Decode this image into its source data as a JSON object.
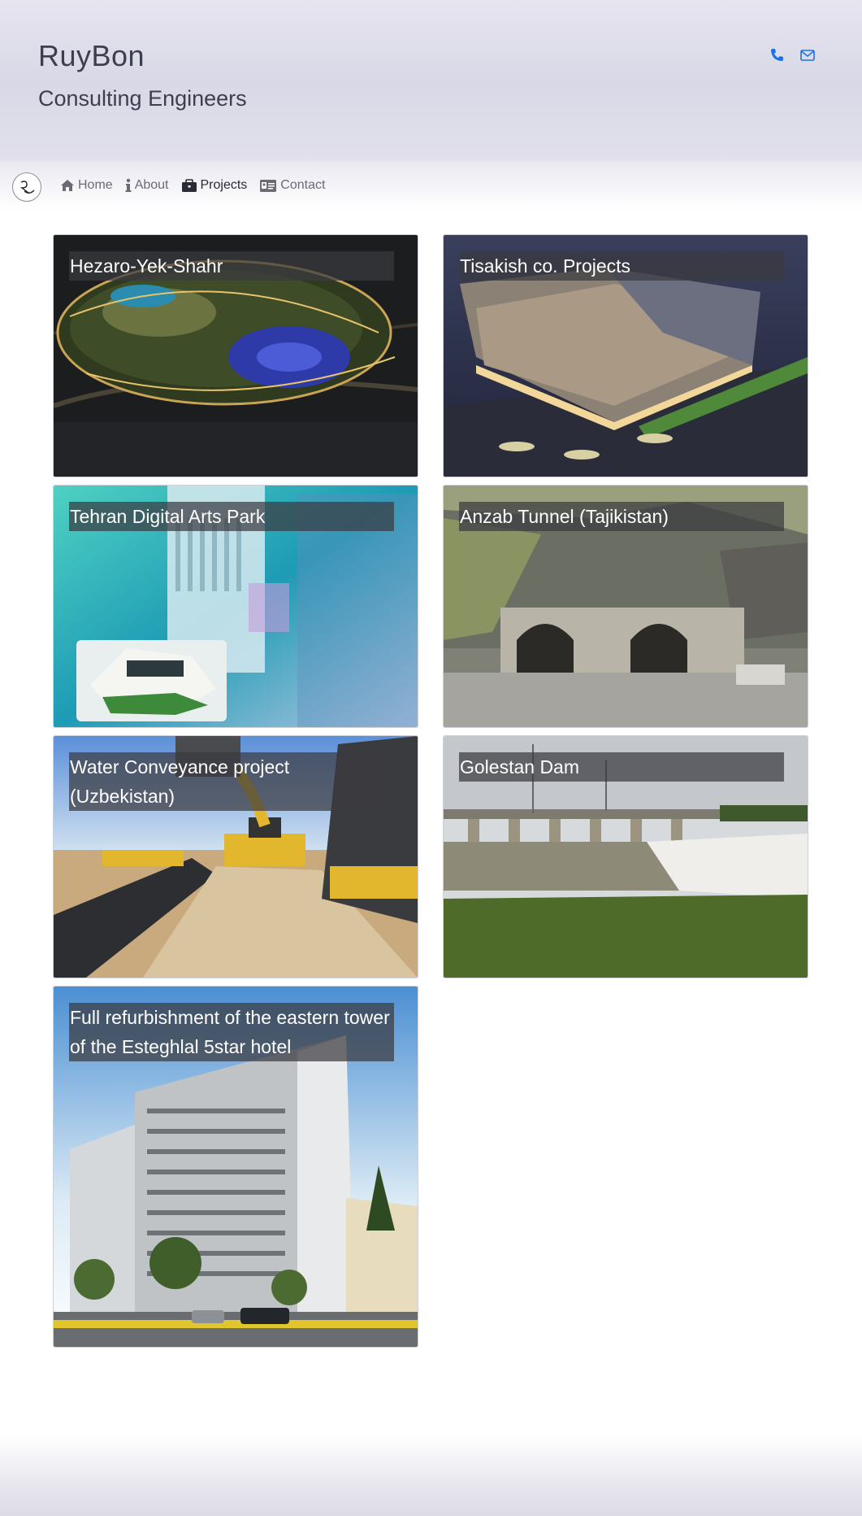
{
  "header": {
    "brand": "RuyBon",
    "tagline": "Consulting Engineers",
    "icons": [
      "phone-icon",
      "envelope-icon"
    ],
    "accent_color": "#1a73e8"
  },
  "nav": {
    "items": [
      {
        "label": "Home",
        "icon": "home-icon"
      },
      {
        "label": "About",
        "icon": "info-icon"
      },
      {
        "label": "Projects",
        "icon": "briefcase-icon",
        "active": true
      },
      {
        "label": "Contact",
        "icon": "id-card-icon"
      }
    ]
  },
  "projects": [
    {
      "title": "Hezaro-Yek-Shahr"
    },
    {
      "title": "Tisakish co. Projects"
    },
    {
      "title": "Tehran Digital Arts Park"
    },
    {
      "title": "Anzab Tunnel (Tajikistan)"
    },
    {
      "title": "Water Conveyance project (Uzbekistan)"
    },
    {
      "title": "Golestan Dam"
    },
    {
      "title": "Full refurbishment of the eastern tower of the Esteghlal 5star hotel"
    }
  ]
}
